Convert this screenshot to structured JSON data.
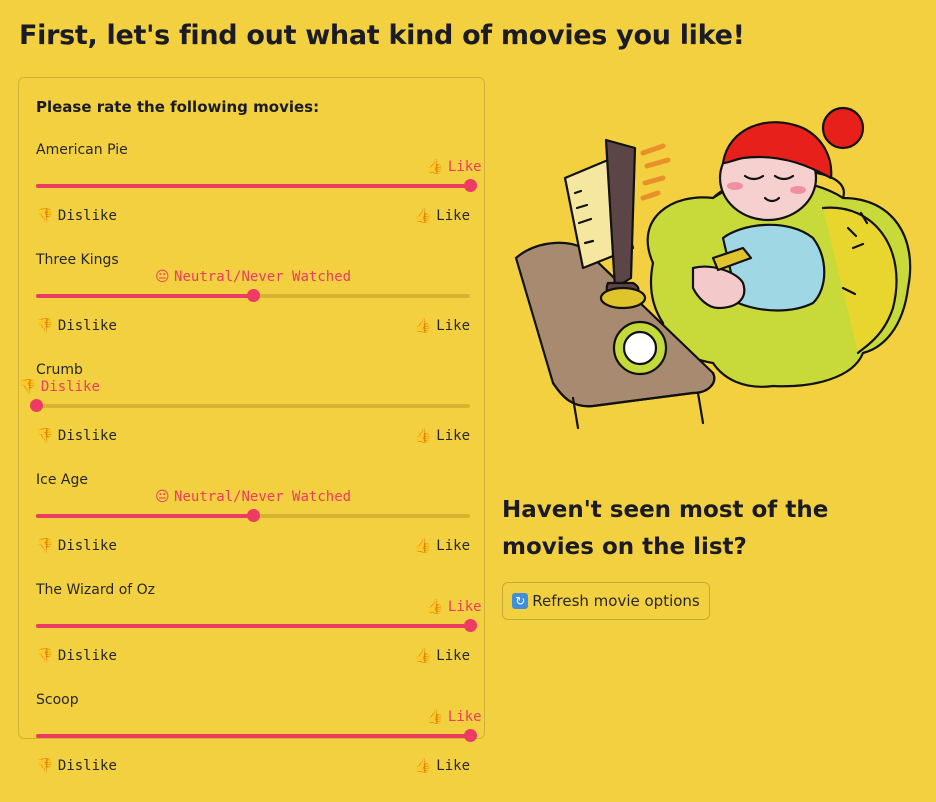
{
  "page": {
    "title": "First, let's find out what kind of movies you like!",
    "rating_heading": "Please rate the following movies:"
  },
  "slider_scale": {
    "min_label": "Dislike",
    "max_label": "Like",
    "min_icon": "thumbs-down-icon",
    "max_icon": "thumbs-up-icon",
    "options": [
      "Dislike",
      "Neutral/Never Watched",
      "Like"
    ]
  },
  "movies": [
    {
      "name": "American Pie",
      "rating": "Like",
      "rating_icon": "thumbs-up-icon",
      "position": 1.0
    },
    {
      "name": "Three Kings",
      "rating": "Neutral/Never Watched",
      "rating_icon": "neutral-face-icon",
      "position": 0.5
    },
    {
      "name": "Crumb",
      "rating": "Dislike",
      "rating_icon": "thumbs-down-icon",
      "position": 0.0
    },
    {
      "name": "Ice Age",
      "rating": "Neutral/Never Watched",
      "rating_icon": "neutral-face-icon",
      "position": 0.5
    },
    {
      "name": "The Wizard of Oz",
      "rating": "Like",
      "rating_icon": "thumbs-up-icon",
      "position": 1.0
    },
    {
      "name": "Scoop",
      "rating": "Like",
      "rating_icon": "thumbs-up-icon",
      "position": 1.0
    }
  ],
  "sidebar": {
    "illustration_icon": "person-watching-tv-illustration",
    "subheading": "Haven't seen most of the movies on the list?",
    "refresh_button": {
      "label": "Refresh movie options",
      "icon": "refresh-icon"
    }
  },
  "colors": {
    "background": "#f2d03f",
    "accent": "#ec3c64",
    "track": "#d7b332",
    "text": "#262730"
  }
}
